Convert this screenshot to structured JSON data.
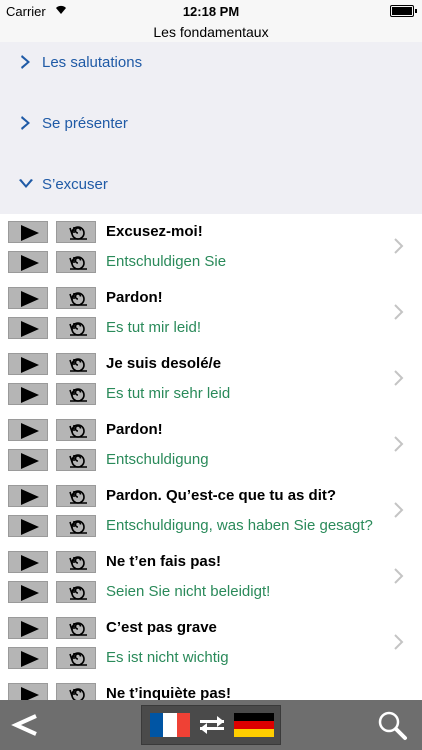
{
  "status_bar": {
    "carrier": "Carrier",
    "time": "12:18 PM"
  },
  "header": {
    "title": "Les fondamentaux"
  },
  "sections": [
    {
      "label": "Les salutations",
      "expanded": false
    },
    {
      "label": "Se présenter",
      "expanded": false
    },
    {
      "label": "S’excuser",
      "expanded": true
    }
  ],
  "phrases": [
    {
      "fr": "Excusez-moi!",
      "de": "Entschuldigen Sie"
    },
    {
      "fr": "Pardon!",
      "de": "Es tut mir leid!"
    },
    {
      "fr": "Je suis desolé/e",
      "de": "Es tut mir sehr leid"
    },
    {
      "fr": "Pardon!",
      "de": "Entschuldigung"
    },
    {
      "fr": "Pardon. Qu’est-ce que tu as dit?",
      "de": "Entschuldigung, was haben Sie gesagt?"
    },
    {
      "fr": "Ne t’en fais pas!",
      "de": "Seien Sie nicht beleidigt!"
    },
    {
      "fr": "C’est pas grave",
      "de": "Es ist nicht wichtig"
    },
    {
      "fr": "Ne t’inquiète pas!",
      "de": ""
    }
  ],
  "toolbar": {
    "back_icon": "chevron-left-icon",
    "source_flag": "france-flag",
    "target_flag": "germany-flag",
    "swap_icon": "swap-arrows-icon",
    "search_icon": "magnifier-icon"
  },
  "colors": {
    "section_text": "#1f5aa6",
    "german_text": "#2a8a5a",
    "toolbar_bg": "#6e6e6e",
    "section_bg": "#efeff4"
  }
}
